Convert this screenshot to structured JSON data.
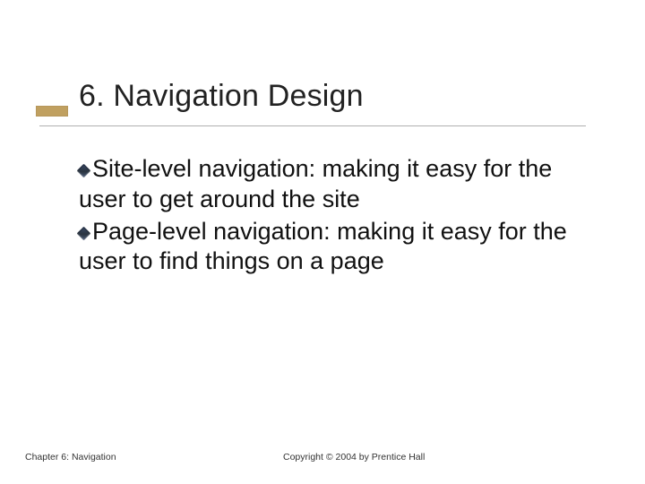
{
  "title": "6. Navigation Design",
  "bullets": [
    "Site-level navigation: making it easy for the user to get around the site",
    "Page-level navigation: making it easy for the user to find things on a page"
  ],
  "footer": {
    "left": "Chapter 6: Navigation",
    "right": "Copyright © 2004 by Prentice Hall"
  }
}
